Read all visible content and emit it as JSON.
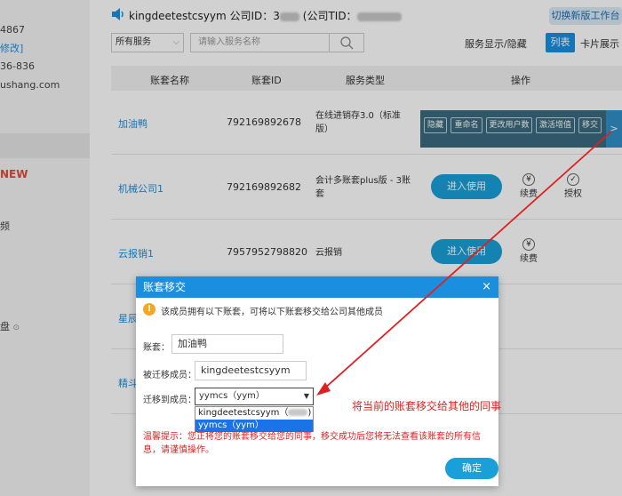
{
  "sidebar": {
    "phone_fragment": "4867",
    "edit_link": "修改]",
    "tel_fragment": "36-836",
    "email_fragment": "ushang.com",
    "new_badge": "NEW",
    "video_fragment": "频",
    "disk_fragment": "盘"
  },
  "header": {
    "account_name": "kingdeetestcsyym",
    "company_id_label": "公司ID：",
    "company_id_prefix": "3",
    "company_tid_label": "(公司TID：",
    "switch_button": "切换新版工作台"
  },
  "filter": {
    "service_select": "所有服务",
    "search_placeholder": "请输入服务名称",
    "toggle_label": "服务显示/隐藏",
    "list_view": "列表",
    "card_view": "卡片展示"
  },
  "table": {
    "headers": [
      "账套名称",
      "账套ID",
      "服务类型",
      "操作"
    ],
    "rows": [
      {
        "name": "加油鸭",
        "id": "792169892678",
        "service": "在线进销存3.0（标准版）"
      },
      {
        "name": "机械公司1",
        "id": "792169892682",
        "service": "会计多账套plus版 - 3账套"
      },
      {
        "name": "云报销1",
        "id": "7957952798820",
        "service": "云报销"
      },
      {
        "name": "星辰",
        "id": "",
        "service": ""
      },
      {
        "name": "精斗",
        "id": "",
        "service": ""
      }
    ],
    "enter_button": "进入使用",
    "renew_label": "续费",
    "authorize_label": "授权",
    "action_bar": [
      "隐藏",
      "重命名",
      "更改用户数",
      "激活增值",
      "移交"
    ],
    "side_tab_glyph": ">",
    "side_tab_glyph_alt": "<"
  },
  "modal": {
    "title": "账套移交",
    "close": "×",
    "notice": "该成员拥有以下账套，可将以下账套移交给公司其他成员",
    "account_label": "账套：",
    "account_value": "加油鸭",
    "from_label": "被迁移成员：",
    "from_value": "kingdeetestcsyym",
    "to_label": "迁移到成员：",
    "to_value": "yymcs（yym）",
    "options": [
      "kingdeetestcsyym（",
      "yymcs（yym）"
    ],
    "tip": "温馨提示：您正将您的账套移交给您的同事，移交成功后您将无法查看该账套的所有信息，请谨慎操作。",
    "confirm": "确定"
  },
  "annotation": {
    "text": "将当前的账套移交给其他的同事",
    "color": "#e02020"
  },
  "colors": {
    "primary": "#1a8fe0",
    "button": "#1aa0d8",
    "warning": "#f5a623",
    "alert": "#e02020"
  }
}
